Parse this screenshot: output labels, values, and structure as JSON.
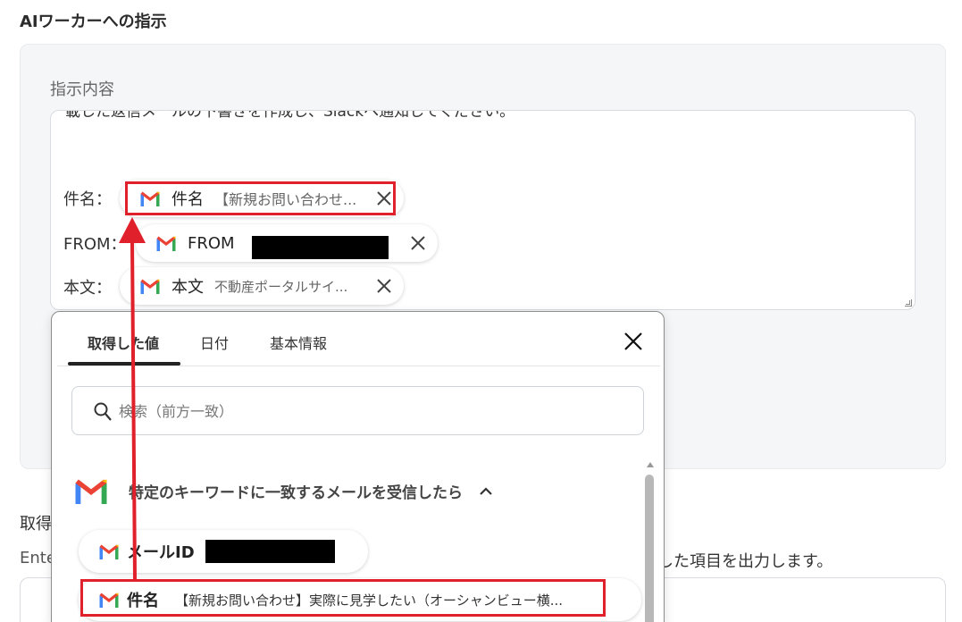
{
  "section": {
    "title": "AIワーカーへの指示"
  },
  "instruction": {
    "label": "指示内容",
    "cut_line": "載した返信メールの下書きを作成し、Slackへ通知してください。",
    "lines": [
      {
        "label": "件名：",
        "chip_name": "件名",
        "chip_value": "【新規お問い合わせ..."
      },
      {
        "label": "FROM：",
        "chip_name": "FROM",
        "chip_value": ""
      },
      {
        "label": "本文：",
        "chip_name": "本文",
        "chip_value": "不動産ポータルサイ..."
      }
    ]
  },
  "dropdown": {
    "tabs": [
      "取得した値",
      "日付",
      "基本情報"
    ],
    "active_tab": "取得した値",
    "search_placeholder": "検索（前方一致）",
    "group_title": "特定のキーワードに一致するメールを受信したら",
    "items": [
      {
        "name": "メールID",
        "value": ""
      },
      {
        "name": "件名",
        "value": "【新規お問い合わせ】実際に見学したい（オーシャンビュー横..."
      }
    ]
  },
  "background": {
    "label_fragment": "取得",
    "left_fragment": "Ente",
    "right_fragment": "した項目を出力します。"
  },
  "icons": {
    "gmail": "gmail-icon",
    "close": "close-icon",
    "search": "search-icon",
    "chevron": "chevron-up-icon"
  },
  "colors": {
    "highlight": "#e0202a",
    "gmail_red": "#ea4335",
    "gmail_blue": "#4285f4",
    "gmail_green": "#34a853",
    "gmail_yellow": "#fbbc04"
  }
}
